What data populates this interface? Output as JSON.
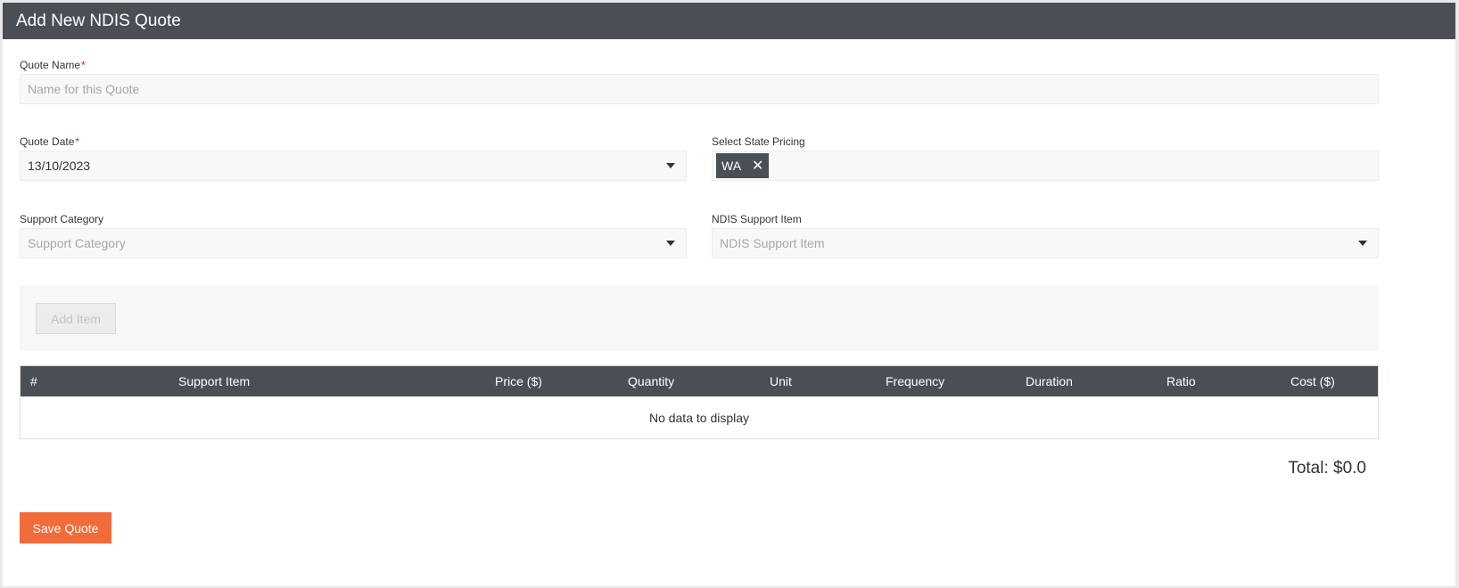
{
  "header": {
    "title": "Add New NDIS Quote"
  },
  "quote_name": {
    "label": "Quote Name",
    "required_mark": "*",
    "placeholder": "Name for this Quote",
    "value": ""
  },
  "quote_date": {
    "label": "Quote Date",
    "required_mark": "*",
    "value": "13/10/2023"
  },
  "state_pricing": {
    "label": "Select State Pricing",
    "selected_tag": "WA",
    "remove_icon": "✕"
  },
  "support_category": {
    "label": "Support Category",
    "placeholder": "Support Category"
  },
  "support_item": {
    "label": "NDIS Support Item",
    "placeholder": "NDIS Support Item"
  },
  "add_item": {
    "label": "Add Item"
  },
  "table": {
    "columns": [
      "#",
      "Support Item",
      "Price ($)",
      "Quantity",
      "Unit",
      "Frequency",
      "Duration",
      "Ratio",
      "Cost ($)"
    ],
    "empty_text": "No data to display"
  },
  "total": {
    "text": "Total: $0.0"
  },
  "save": {
    "label": "Save Quote"
  },
  "colors": {
    "header_bg": "#4a4f55",
    "accent": "#f26b3a",
    "required": "#e02424"
  }
}
